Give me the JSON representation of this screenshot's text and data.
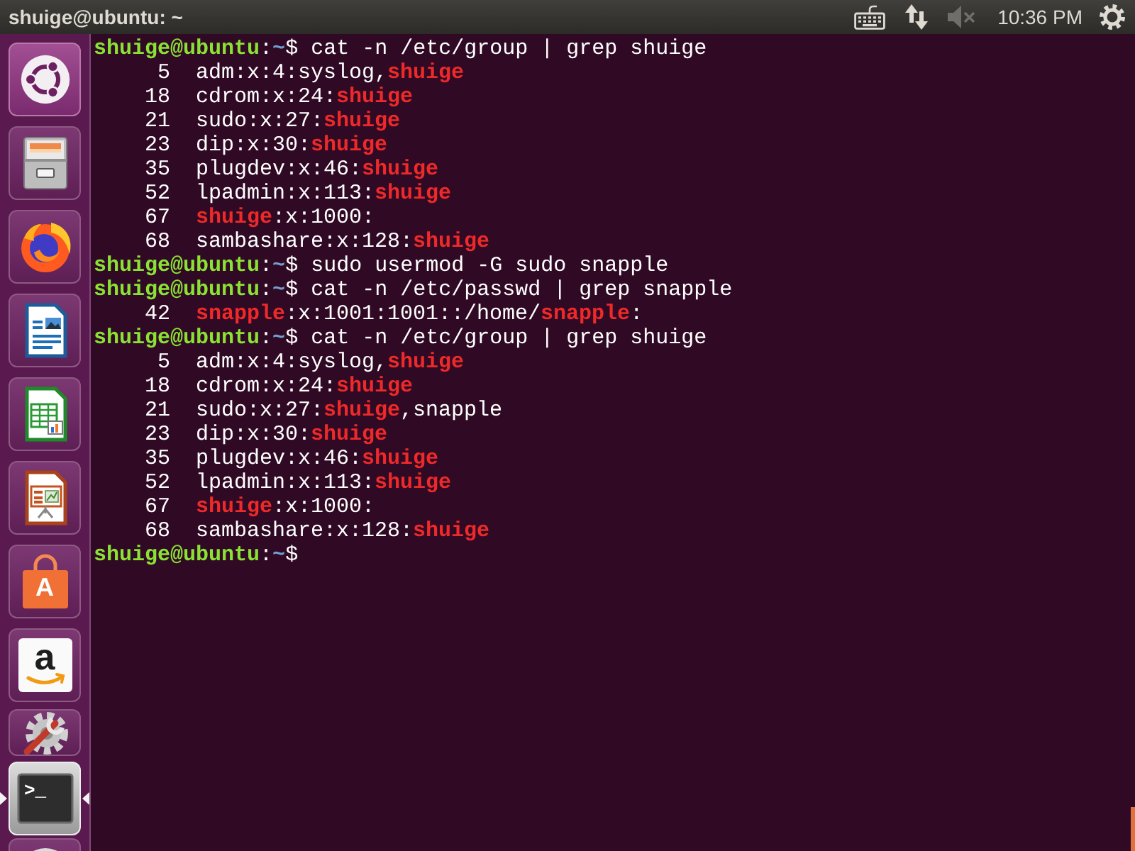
{
  "top_bar": {
    "title": "shuige@ubuntu: ~",
    "indicators": [
      {
        "kind": "keyboard"
      },
      {
        "kind": "network"
      },
      {
        "kind": "sound",
        "muted": true
      },
      {
        "kind": "clock",
        "text": "10:36 PM"
      },
      {
        "kind": "session"
      }
    ]
  },
  "launcher": {
    "items": [
      {
        "kind": "dash",
        "running": false,
        "focused": false
      },
      {
        "kind": "files",
        "running": false,
        "focused": false
      },
      {
        "kind": "browser",
        "running": false,
        "focused": false
      },
      {
        "kind": "writer",
        "running": false,
        "focused": false
      },
      {
        "kind": "calc",
        "running": false,
        "focused": false
      },
      {
        "kind": "impress",
        "running": false,
        "focused": false
      },
      {
        "kind": "software",
        "glyph": "A",
        "running": false,
        "focused": false
      },
      {
        "kind": "amazon",
        "glyph": "a",
        "running": false,
        "focused": false
      },
      {
        "kind": "settings",
        "running": false,
        "focused": false
      },
      {
        "kind": "terminal",
        "glyph": ">_",
        "running": true,
        "focused": true
      },
      {
        "kind": "disc",
        "running": false,
        "focused": false
      }
    ]
  },
  "terminal": {
    "lines": [
      {
        "kind": "prompt",
        "user_host": "shuige@ubuntu",
        "separator": ":",
        "path": "~",
        "symbol": "$",
        "command": "cat -n /etc/group | grep shuige"
      },
      {
        "kind": "output",
        "number": "5",
        "parts": [
          {
            "text": "adm:x:4:syslog,",
            "match": false
          },
          {
            "text": "shuige",
            "match": true
          }
        ]
      },
      {
        "kind": "output",
        "number": "18",
        "parts": [
          {
            "text": "cdrom:x:24:",
            "match": false
          },
          {
            "text": "shuige",
            "match": true
          }
        ]
      },
      {
        "kind": "output",
        "number": "21",
        "parts": [
          {
            "text": "sudo:x:27:",
            "match": false
          },
          {
            "text": "shuige",
            "match": true
          }
        ]
      },
      {
        "kind": "output",
        "number": "23",
        "parts": [
          {
            "text": "dip:x:30:",
            "match": false
          },
          {
            "text": "shuige",
            "match": true
          }
        ]
      },
      {
        "kind": "output",
        "number": "35",
        "parts": [
          {
            "text": "plugdev:x:46:",
            "match": false
          },
          {
            "text": "shuige",
            "match": true
          }
        ]
      },
      {
        "kind": "output",
        "number": "52",
        "parts": [
          {
            "text": "lpadmin:x:113:",
            "match": false
          },
          {
            "text": "shuige",
            "match": true
          }
        ]
      },
      {
        "kind": "output",
        "number": "67",
        "parts": [
          {
            "text": "shuige",
            "match": true
          },
          {
            "text": ":x:1000:",
            "match": false
          }
        ]
      },
      {
        "kind": "output",
        "number": "68",
        "parts": [
          {
            "text": "sambashare:x:128:",
            "match": false
          },
          {
            "text": "shuige",
            "match": true
          }
        ]
      },
      {
        "kind": "prompt",
        "user_host": "shuige@ubuntu",
        "separator": ":",
        "path": "~",
        "symbol": "$",
        "command": "sudo usermod -G sudo snapple"
      },
      {
        "kind": "prompt",
        "user_host": "shuige@ubuntu",
        "separator": ":",
        "path": "~",
        "symbol": "$",
        "command": "cat -n /etc/passwd | grep snapple"
      },
      {
        "kind": "output",
        "number": "42",
        "parts": [
          {
            "text": "snapple",
            "match": true
          },
          {
            "text": ":x:1001:1001::/home/",
            "match": false
          },
          {
            "text": "snapple",
            "match": true
          },
          {
            "text": ":",
            "match": false
          }
        ]
      },
      {
        "kind": "prompt",
        "user_host": "shuige@ubuntu",
        "separator": ":",
        "path": "~",
        "symbol": "$",
        "command": "cat -n /etc/group | grep shuige"
      },
      {
        "kind": "output",
        "number": "5",
        "parts": [
          {
            "text": "adm:x:4:syslog,",
            "match": false
          },
          {
            "text": "shuige",
            "match": true
          }
        ]
      },
      {
        "kind": "output",
        "number": "18",
        "parts": [
          {
            "text": "cdrom:x:24:",
            "match": false
          },
          {
            "text": "shuige",
            "match": true
          }
        ]
      },
      {
        "kind": "output",
        "number": "21",
        "parts": [
          {
            "text": "sudo:x:27:",
            "match": false
          },
          {
            "text": "shuige",
            "match": true
          },
          {
            "text": ",snapple",
            "match": false
          }
        ]
      },
      {
        "kind": "output",
        "number": "23",
        "parts": [
          {
            "text": "dip:x:30:",
            "match": false
          },
          {
            "text": "shuige",
            "match": true
          }
        ]
      },
      {
        "kind": "output",
        "number": "35",
        "parts": [
          {
            "text": "plugdev:x:46:",
            "match": false
          },
          {
            "text": "shuige",
            "match": true
          }
        ]
      },
      {
        "kind": "output",
        "number": "52",
        "parts": [
          {
            "text": "lpadmin:x:113:",
            "match": false
          },
          {
            "text": "shuige",
            "match": true
          }
        ]
      },
      {
        "kind": "output",
        "number": "67",
        "parts": [
          {
            "text": "shuige",
            "match": true
          },
          {
            "text": ":x:1000:",
            "match": false
          }
        ]
      },
      {
        "kind": "output",
        "number": "68",
        "parts": [
          {
            "text": "sambashare:x:128:",
            "match": false
          },
          {
            "text": "shuige",
            "match": true
          }
        ]
      },
      {
        "kind": "prompt",
        "user_host": "shuige@ubuntu",
        "separator": ":",
        "path": "~",
        "symbol": "$"
      }
    ]
  }
}
